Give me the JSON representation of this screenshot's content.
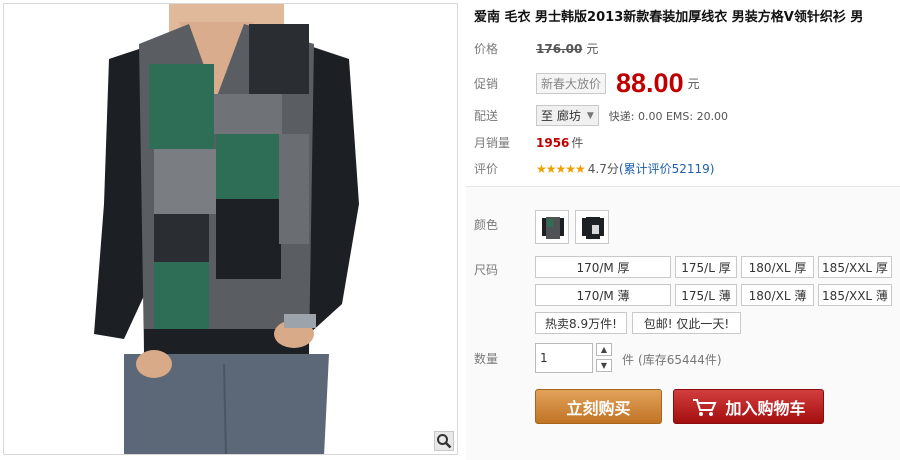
{
  "product": {
    "title": "爱南 毛衣 男士韩版2013新款春装加厚线衣 男装方格V领针织衫 男",
    "zoom_icon": "magnifier-icon"
  },
  "price": {
    "label": "价格",
    "original": "176.00",
    "unit": "元"
  },
  "promo": {
    "label": "促销",
    "tag": "新春大放价",
    "price": "88.00",
    "unit": "元"
  },
  "delivery": {
    "label": "配送",
    "location": "至 廊坊",
    "shipping": "快递: 0.00 EMS: 20.00"
  },
  "sales": {
    "label": "月销量",
    "count": "1956",
    "unit": "件"
  },
  "review": {
    "label": "评价",
    "stars": "★★★★★",
    "score": "4.7分",
    "link": "(累计评价52119)"
  },
  "color": {
    "label": "颜色",
    "options": [
      "green-grey sweater",
      "black sweater"
    ]
  },
  "size": {
    "label": "尺码",
    "options": [
      "170/M 厚",
      "175/L 厚",
      "180/XL 厚",
      "185/XXL 厚",
      "170/M 薄",
      "175/L 薄",
      "180/XL 薄",
      "185/XXL 薄"
    ],
    "extra": [
      "热卖8.9万件!",
      "包邮! 仅此一天!"
    ]
  },
  "quantity": {
    "label": "数量",
    "value": "1",
    "unit": "件",
    "stock": "(库存65444件)"
  },
  "actions": {
    "buy": "立刻购买",
    "cart": "加入购物车"
  },
  "colors": {
    "price_red": "#c00000",
    "buy_orange": "#d08a3e",
    "cart_red": "#b81c1c",
    "link_blue": "#1f5fae"
  }
}
